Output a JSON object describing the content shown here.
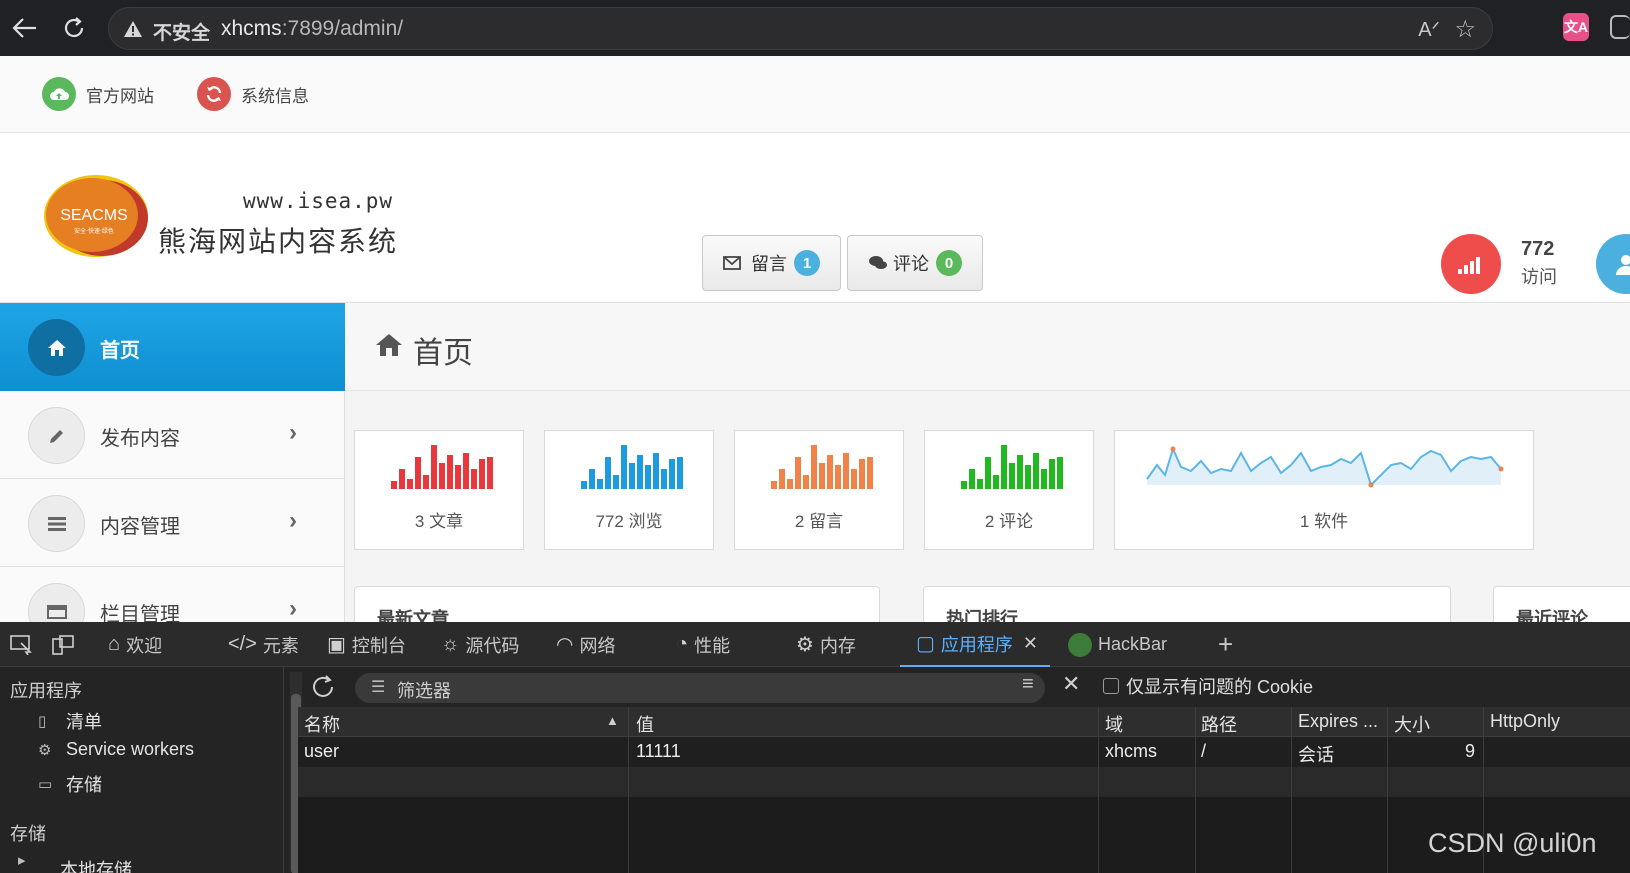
{
  "browser": {
    "insecure_label": "不安全",
    "url_host": "xhcms",
    "url_rest": ":7899/admin/",
    "translate_icon": "文A"
  },
  "topnav": {
    "items": [
      {
        "label": "官方网站",
        "icon": "cloud-upload-icon",
        "color": "#5cb85c"
      },
      {
        "label": "系统信息",
        "icon": "refresh-icon",
        "color": "#d9534f"
      }
    ]
  },
  "header": {
    "logo_text": "SEACMS",
    "logo_subtext": "安全·快速·绿色",
    "site_url": "www.isea.pw",
    "site_name": "熊海网站内容系统",
    "messages_label": "留言",
    "messages_count": "1",
    "comments_label": "评论",
    "comments_count": "0",
    "visits_count": "772",
    "visits_label": "访问"
  },
  "sidebar": {
    "items": [
      {
        "label": "首页",
        "icon": "home-icon",
        "active": true
      },
      {
        "label": "发布内容",
        "icon": "pencil-icon"
      },
      {
        "label": "内容管理",
        "icon": "list-icon"
      },
      {
        "label": "栏目管理",
        "icon": "folder-icon"
      }
    ],
    "chevron": "›"
  },
  "main": {
    "page_title": "首页",
    "stats": [
      {
        "caption": "3 文章",
        "color": "#e8383d"
      },
      {
        "caption": "772 浏览",
        "color": "#1e9be0"
      },
      {
        "caption": "2 留言",
        "color": "#f0824a"
      },
      {
        "caption": "2 评论",
        "color": "#22b822"
      },
      {
        "caption": "1 软件",
        "color": "#5bb5e6"
      }
    ],
    "panels": [
      {
        "title": "最新文章"
      },
      {
        "title": "热门排行"
      },
      {
        "title": "最近评论"
      }
    ]
  },
  "devtools": {
    "tabs": [
      {
        "label": "欢迎",
        "icon": "home-icon"
      },
      {
        "label": "元素",
        "icon": "code-icon"
      },
      {
        "label": "控制台",
        "icon": "console-icon"
      },
      {
        "label": "源代码",
        "icon": "bug-icon"
      },
      {
        "label": "网络",
        "icon": "wifi-icon"
      },
      {
        "label": "性能",
        "icon": "gauge-icon"
      },
      {
        "label": "内存",
        "icon": "chip-icon"
      },
      {
        "label": "应用程序",
        "icon": "app-icon"
      },
      {
        "label": "HackBar",
        "icon": "hackbar-icon"
      }
    ],
    "left_panel": {
      "app_section": "应用程序",
      "app_items": [
        "清单",
        "Service workers",
        "存储"
      ],
      "storage_section": "存储",
      "storage_items": [
        "本地存储"
      ]
    },
    "filter_placeholder": "筛选器",
    "only_issues_label": "仅显示有问题的 Cookie",
    "columns": [
      "名称",
      "值",
      "域",
      "路径",
      "Expires ...",
      "大小",
      "HttpOnly"
    ],
    "rows": [
      {
        "name": "user",
        "value": "11111",
        "domain": "xhcms",
        "path": "/",
        "expires": "会话",
        "size": "9"
      }
    ]
  },
  "watermark": "CSDN @uli0n"
}
